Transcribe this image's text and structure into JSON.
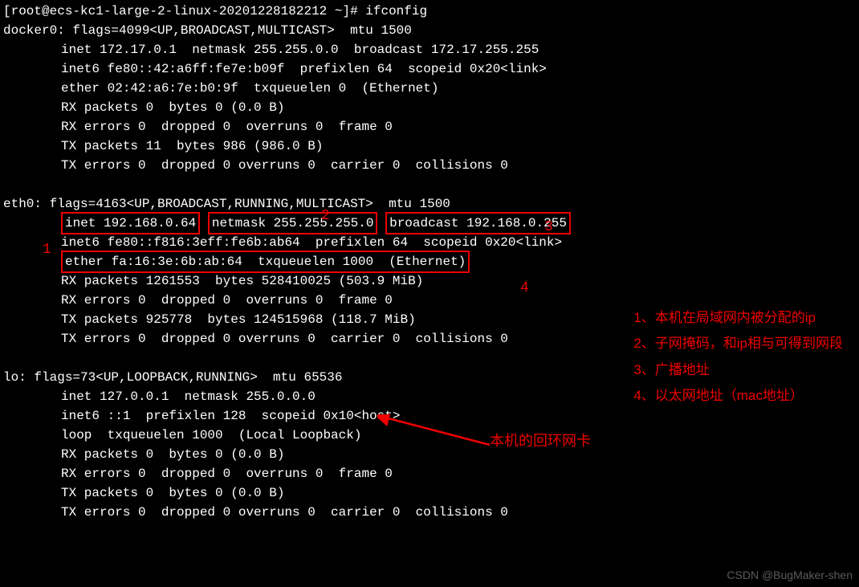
{
  "prompt": "[root@ecs-kc1-large-2-linux-20201228182212 ~]# ifconfig",
  "docker0": {
    "header": "docker0: flags=4099<UP,BROADCAST,MULTICAST>  mtu 1500",
    "l1": "inet 172.17.0.1  netmask 255.255.0.0  broadcast 172.17.255.255",
    "l2": "inet6 fe80::42:a6ff:fe7e:b09f  prefixlen 64  scopeid 0x20<link>",
    "l3": "ether 02:42:a6:7e:b0:9f  txqueuelen 0  (Ethernet)",
    "l4": "RX packets 0  bytes 0 (0.0 B)",
    "l5": "RX errors 0  dropped 0  overruns 0  frame 0",
    "l6": "TX packets 11  bytes 986 (986.0 B)",
    "l7": "TX errors 0  dropped 0 overruns 0  carrier 0  collisions 0"
  },
  "eth0": {
    "header": "eth0: flags=4163<UP,BROADCAST,RUNNING,MULTICAST>  mtu 1500",
    "box1": "inet 192.168.0.64",
    "box2": "netmask 255.255.255.0",
    "box3": "broadcast 192.168.0.255",
    "l2": "inet6 fe80::f816:3eff:fe6b:ab64  prefixlen 64  scopeid 0x20<link>",
    "box4": "ether fa:16:3e:6b:ab:64  txqueuelen 1000  (Ethernet)",
    "l4": "RX packets 1261553  bytes 528410025 (503.9 MiB)",
    "l5": "RX errors 0  dropped 0  overruns 0  frame 0",
    "l6": "TX packets 925778  bytes 124515968 (118.7 MiB)",
    "l7": "TX errors 0  dropped 0 overruns 0  carrier 0  collisions 0"
  },
  "lo": {
    "header": "lo: flags=73<UP,LOOPBACK,RUNNING>  mtu 65536",
    "l1": "inet 127.0.0.1  netmask 255.0.0.0",
    "l2": "inet6 ::1  prefixlen 128  scopeid 0x10<host>",
    "l3": "loop  txqueuelen 1000  (Local Loopback)",
    "l4": "RX packets 0  bytes 0 (0.0 B)",
    "l5": "RX errors 0  dropped 0  overruns 0  frame 0",
    "l6": "TX packets 0  bytes 0 (0.0 B)",
    "l7": "TX errors 0  dropped 0 overruns 0  carrier 0  collisions 0"
  },
  "nums": {
    "n1": "1",
    "n2": "2",
    "n3": "3",
    "n4": "4"
  },
  "annot": {
    "a1": "1、本机在局域网内被分配的ip",
    "a2": "2、子网掩码，和ip相与可得到网段",
    "a3": "3、广播地址",
    "a4": "4、以太网地址（mac地址）"
  },
  "loop_label": "本机的回环网卡",
  "watermark": "CSDN @BugMaker-shen"
}
